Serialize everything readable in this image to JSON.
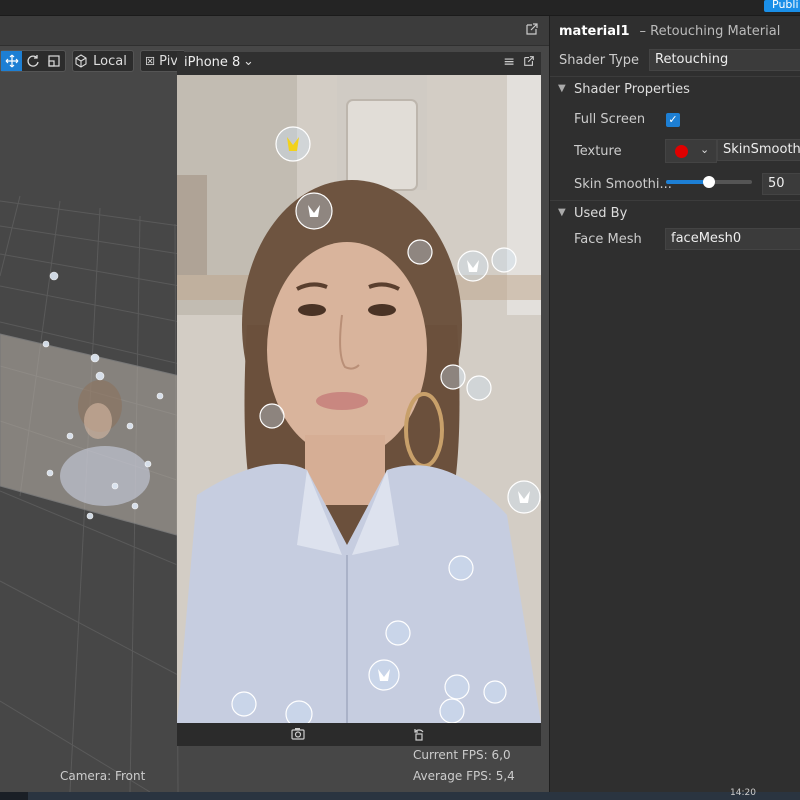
{
  "topbar": {
    "publish_label": "Publi"
  },
  "toolbar": {
    "local_label": "Local",
    "pivot_label": "Piv"
  },
  "device": {
    "name": "iPhone 8"
  },
  "stats": {
    "current_fps_label": "Current FPS:",
    "current_fps": "6,0",
    "average_fps_label": "Average FPS:",
    "average_fps": "5,4"
  },
  "camera_label": "Camera: Front",
  "panel": {
    "material_name": "material1",
    "material_type": "– Retouching Material",
    "shader_type_label": "Shader Type",
    "shader_type_value": "Retouching",
    "shader_properties_label": "Shader Properties",
    "full_screen_label": "Full Screen",
    "full_screen_checked": true,
    "texture_label": "Texture",
    "texture_color": "#e00000",
    "texture_value": "SkinSmoothing",
    "skin_smoothing_label": "Skin Smoothi...",
    "skin_smoothing_value": "50",
    "skin_smoothing_fraction": 0.5,
    "used_by_label": "Used By",
    "face_mesh_label": "Face Mesh",
    "face_mesh_value": "faceMesh0"
  },
  "taskbar": {
    "clock": "14:20"
  },
  "colors": {
    "accent": "#1d7fd4",
    "panel_bg": "#2f2f2f",
    "viewport_bg": "#474747"
  },
  "icons": [
    "move-icon",
    "rotate-icon",
    "scale-icon",
    "cube-icon",
    "pivot-icon",
    "external-link-icon",
    "menu-icon",
    "camera-capture-icon",
    "flip-camera-icon",
    "chevron-down-icon",
    "checkmark-icon"
  ]
}
